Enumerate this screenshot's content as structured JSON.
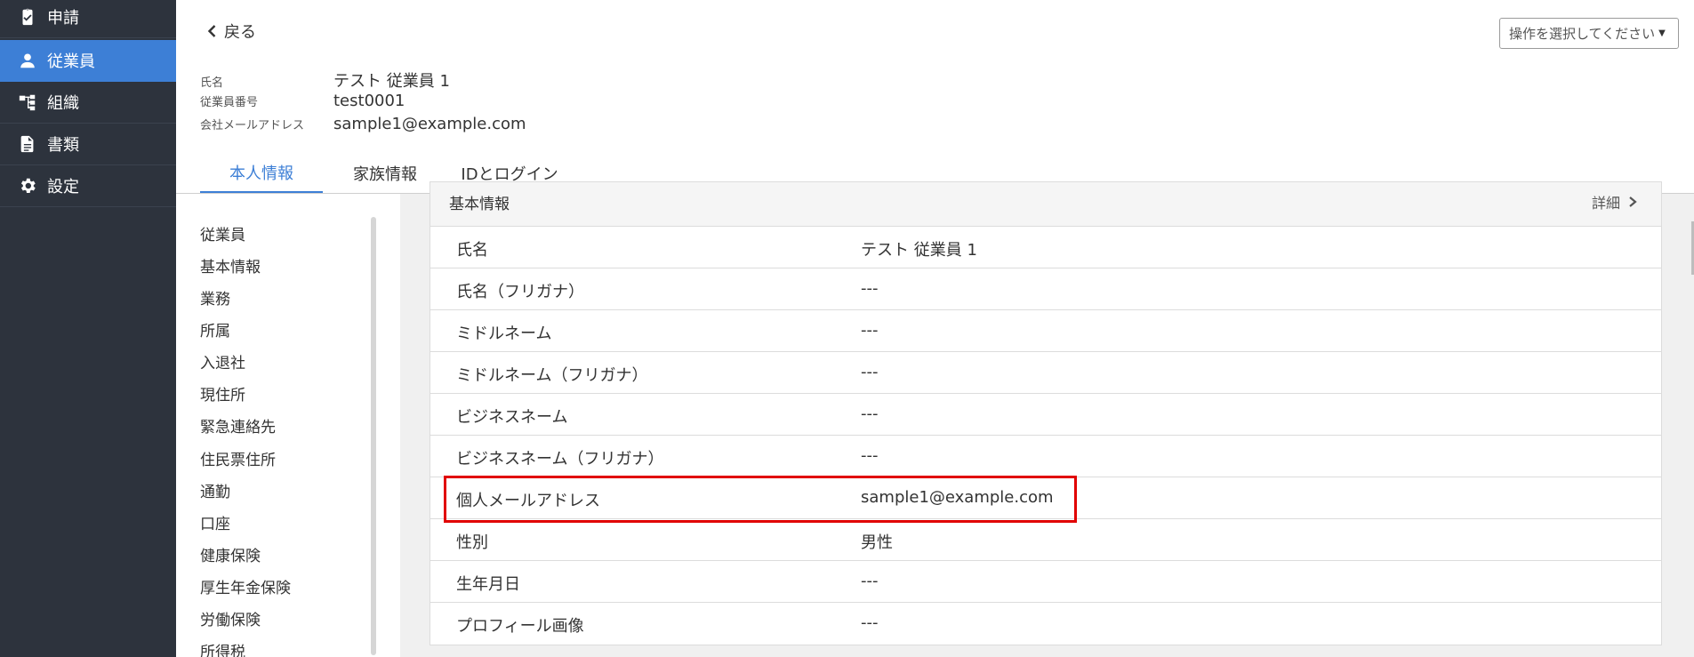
{
  "sidebar": {
    "items": [
      {
        "label": "申請",
        "icon": "clipboard-check-icon",
        "active": false
      },
      {
        "label": "従業員",
        "icon": "person-icon",
        "active": true
      },
      {
        "label": "組織",
        "icon": "org-tree-icon",
        "active": false
      },
      {
        "label": "書類",
        "icon": "document-icon",
        "active": false
      },
      {
        "label": "設定",
        "icon": "gear-icon",
        "active": false
      }
    ]
  },
  "header": {
    "back_label": "戻る",
    "action_placeholder": "操作を選択してください",
    "info": [
      {
        "label": "氏名",
        "value": "テスト 従業員 1"
      },
      {
        "label": "従業員番号",
        "value": "test0001"
      },
      {
        "label": "会社メールアドレス",
        "value": "sample1@example.com"
      }
    ]
  },
  "tabs": [
    {
      "label": "本人情報",
      "active": true
    },
    {
      "label": "家族情報",
      "active": false
    },
    {
      "label": "IDとログイン",
      "active": false
    }
  ],
  "section_menu": [
    "従業員",
    "基本情報",
    "業務",
    "所属",
    "入退社",
    "現住所",
    "緊急連絡先",
    "住民票住所",
    "通勤",
    "口座",
    "健康保険",
    "厚生年金保険",
    "労働保険",
    "所得税"
  ],
  "card": {
    "title": "基本情報",
    "detail_label": "詳細",
    "rows": [
      {
        "key": "氏名",
        "value": "テスト 従業員 1"
      },
      {
        "key": "氏名（フリガナ）",
        "value": "---"
      },
      {
        "key": "ミドルネーム",
        "value": "---"
      },
      {
        "key": "ミドルネーム（フリガナ）",
        "value": "---"
      },
      {
        "key": "ビジネスネーム",
        "value": "---"
      },
      {
        "key": "ビジネスネーム（フリガナ）",
        "value": "---"
      },
      {
        "key": "個人メールアドレス",
        "value": "sample1@example.com"
      },
      {
        "key": "性別",
        "value": "男性"
      },
      {
        "key": "生年月日",
        "value": "---"
      },
      {
        "key": "プロフィール画像",
        "value": "---"
      }
    ]
  },
  "colors": {
    "sidebar_bg": "#2d333d",
    "accent": "#3d7fd6",
    "highlight_border": "#e10000"
  }
}
